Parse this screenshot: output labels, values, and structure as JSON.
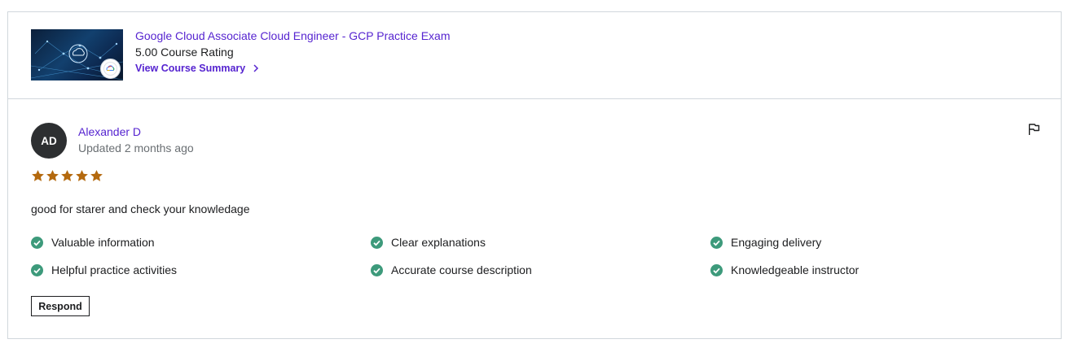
{
  "course": {
    "title": "Google Cloud Associate Cloud Engineer - GCP Practice Exam",
    "rating": "5.00 Course Rating",
    "summary_link": "View Course Summary",
    "thumbnail_icon": "google-cloud-badge"
  },
  "review": {
    "avatar_initials": "AD",
    "reviewer": "Alexander D",
    "updated": "Updated 2 months ago",
    "stars": 5,
    "star_color": "#b4690e",
    "comment": "good for starer and check your knowledage",
    "tags": [
      "Valuable information",
      "Clear explanations",
      "Engaging delivery",
      "Helpful practice activities",
      "Accurate course description",
      "Knowledgeable instructor"
    ],
    "check_color": "#3d9a7b",
    "respond_label": "Respond"
  },
  "colors": {
    "link": "#5624d0",
    "muted": "#6a6f73",
    "border": "#d1d7dc"
  }
}
